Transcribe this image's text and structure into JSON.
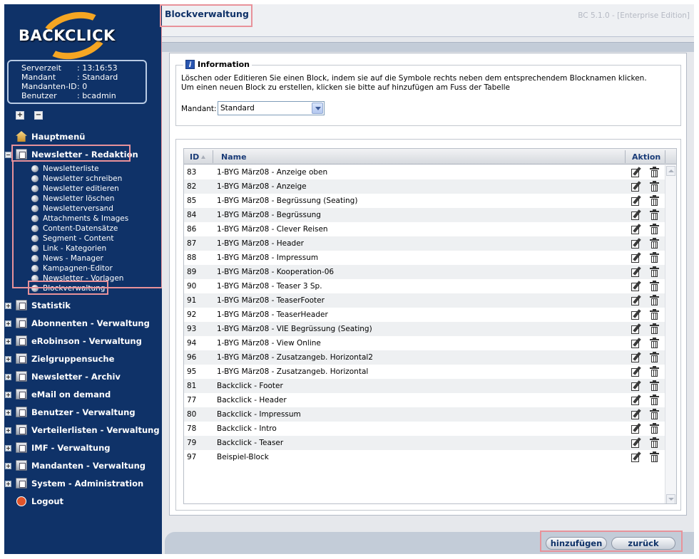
{
  "logo_text": "BACKCLICK",
  "server_info": [
    {
      "label": "Serverzeit",
      "value": ": 13:16:53"
    },
    {
      "label": "Mandant",
      "value": ": Standard"
    },
    {
      "label": "Mandanten-ID",
      "value": ": 0"
    },
    {
      "label": "Benutzer",
      "value": ": bcadmin"
    }
  ],
  "controls": {
    "expand_all": "+",
    "collapse_all": "−"
  },
  "nav": {
    "hauptmenu": "Hauptmenü",
    "redaktion": "Newsletter - Redaktion",
    "redaktion_items": [
      "Newsletterliste",
      "Newsletter schreiben",
      "Newsletter editieren",
      "Newsletter löschen",
      "Newsletterversand",
      "Attachments & Images",
      "Content-Datensätze",
      "Segment - Content",
      "Link - Kategorien",
      "News - Manager",
      "Kampagnen-Editor",
      "Newsletter - Vorlagen",
      "Blockverwaltung"
    ],
    "sections": [
      "Statistik",
      "Abonnenten - Verwaltung",
      "eRobinson - Verwaltung",
      "Zielgruppensuche",
      "Newsletter - Archiv",
      "eMail on demand",
      "Benutzer - Verwaltung",
      "Verteilerlisten - Verwaltung",
      "IMF - Verwaltung",
      "Mandanten - Verwaltung",
      "System - Administration"
    ],
    "logout": "Logout"
  },
  "header": {
    "title": "Blockverwaltung",
    "version": "BC 5.1.0 - [Enterprise Edition]"
  },
  "info": {
    "legend": "Information",
    "line1": "Löschen oder Editieren Sie einen Block, indem sie auf die Symbole rechts neben dem entsprechendem Blocknamen klicken.",
    "line2": "Um einen neuen Block zu erstellen, klicken sie bitte auf hinzufügen am Fuss der Tabelle",
    "mandant_label": "Mandant:",
    "mandant_value": "Standard"
  },
  "table": {
    "columns": {
      "id": "ID",
      "name": "Name",
      "action": "Aktion"
    },
    "rows": [
      {
        "id": "83",
        "name": "1-BYG März08 - Anzeige oben"
      },
      {
        "id": "82",
        "name": "1-BYG März08 - Anzeige"
      },
      {
        "id": "85",
        "name": "1-BYG März08 - Begrüssung (Seating)"
      },
      {
        "id": "84",
        "name": "1-BYG März08 - Begrüssung"
      },
      {
        "id": "86",
        "name": "1-BYG März08 - Clever Reisen"
      },
      {
        "id": "87",
        "name": "1-BYG März08 - Header"
      },
      {
        "id": "88",
        "name": "1-BYG März08 - Impressum"
      },
      {
        "id": "89",
        "name": "1-BYG März08 - Kooperation-06"
      },
      {
        "id": "90",
        "name": "1-BYG März08 - Teaser 3 Sp."
      },
      {
        "id": "91",
        "name": "1-BYG März08 - TeaserFooter"
      },
      {
        "id": "92",
        "name": "1-BYG März08 - TeaserHeader"
      },
      {
        "id": "93",
        "name": "1-BYG März08 - VIE Begrüssung (Seating)"
      },
      {
        "id": "94",
        "name": "1-BYG März08 - View Online"
      },
      {
        "id": "96",
        "name": "1-BYG März08 - Zusatzangeb. Horizontal2"
      },
      {
        "id": "95",
        "name": "1-BYG März08 - Zusatzangeb. Horizontal"
      },
      {
        "id": "81",
        "name": "Backclick - Footer"
      },
      {
        "id": "77",
        "name": "Backclick - Header"
      },
      {
        "id": "80",
        "name": "Backclick - Impressum"
      },
      {
        "id": "78",
        "name": "Backclick - Intro"
      },
      {
        "id": "79",
        "name": "Backclick - Teaser"
      },
      {
        "id": "97",
        "name": "Beispiel-Block"
      }
    ]
  },
  "buttons": {
    "add": "hinzufügen",
    "back": "zurück"
  },
  "colors": {
    "sidebar": "#0f3268",
    "highlight": "#e8929a",
    "accent": "#f5a623"
  }
}
